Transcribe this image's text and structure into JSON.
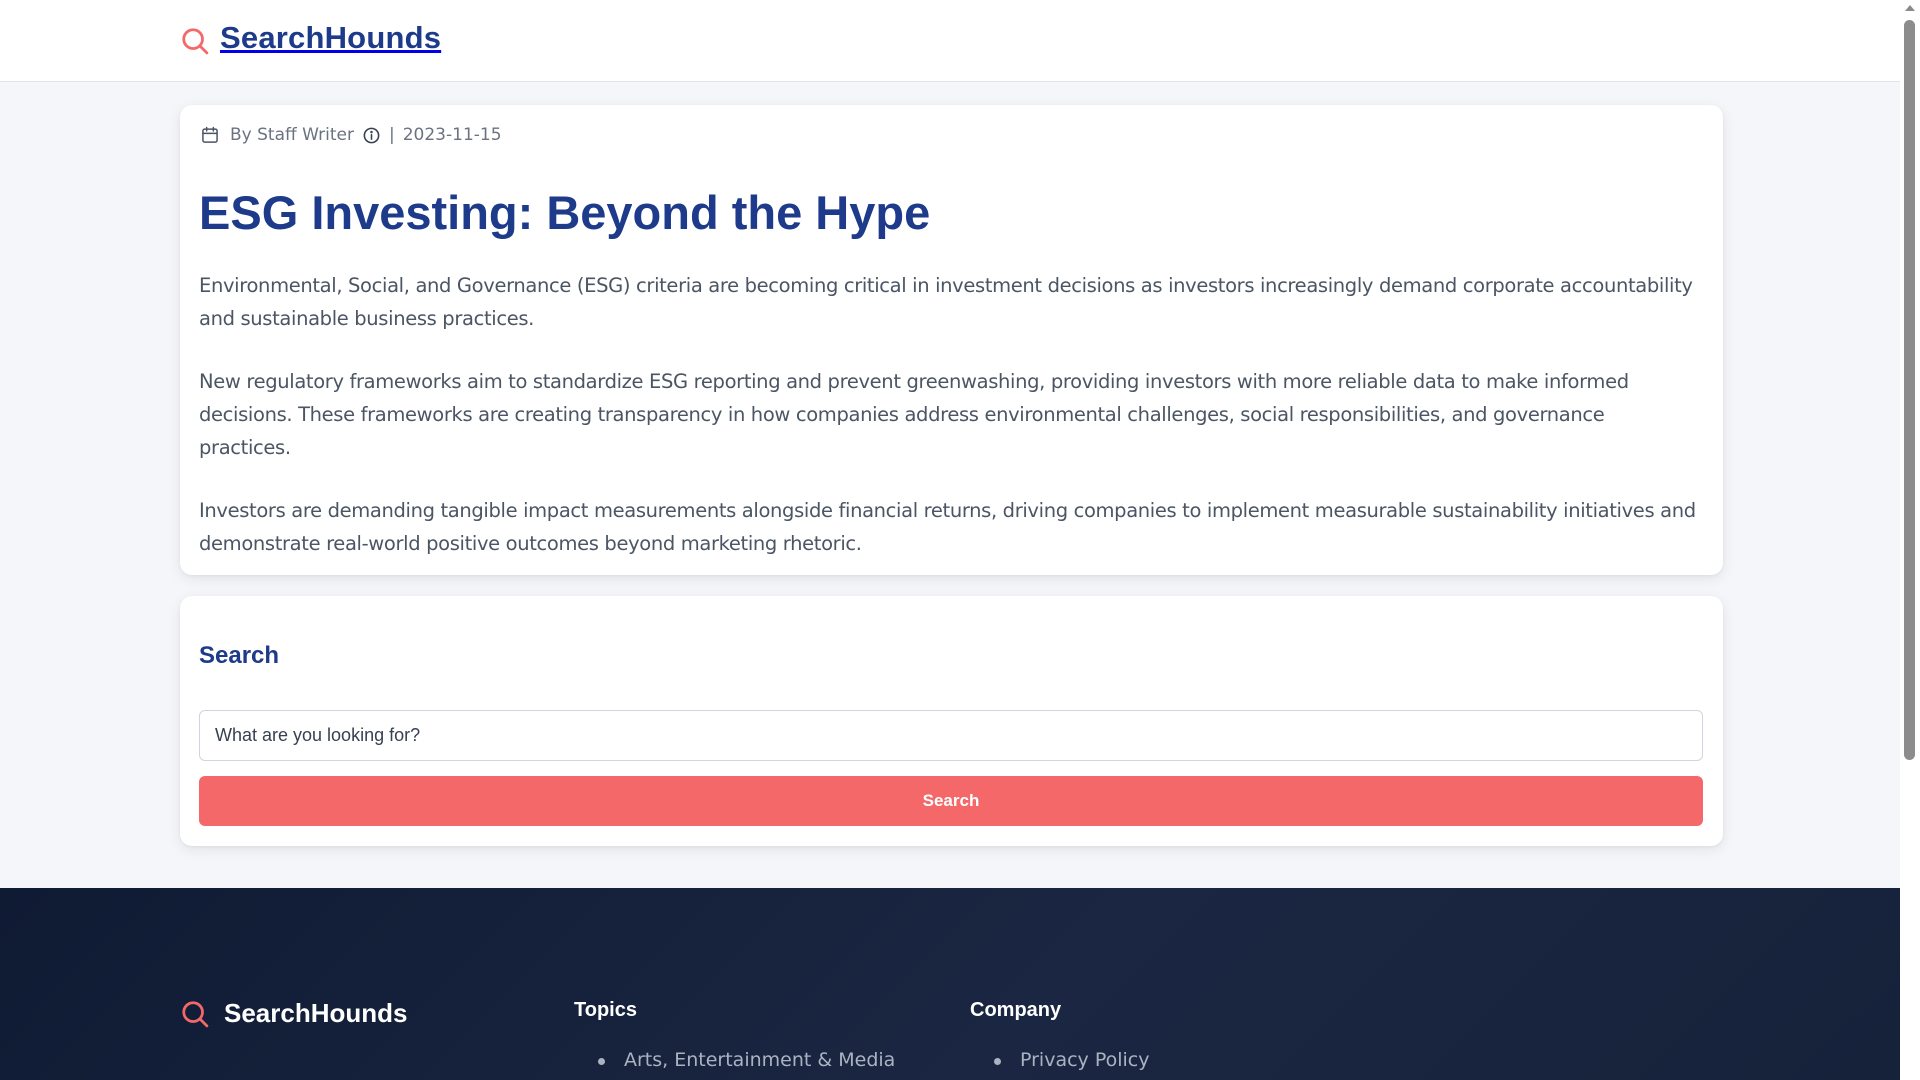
{
  "header": {
    "brand_name": "SearchHounds",
    "logo_icon": "search-icon",
    "accent_color": "#f56869",
    "brand_color": "#1e3a8a"
  },
  "article": {
    "author": "By Staff Writer",
    "separator": "|",
    "date": "2023-11-15",
    "title": "ESG Investing: Beyond the Hype",
    "paragraphs": [
      "Environmental, Social, and Governance (ESG) criteria are becoming critical in investment decisions as investors increasingly demand corporate accountability and sustainable business practices.",
      "New regulatory frameworks aim to standardize ESG reporting and prevent greenwashing, providing investors with more reliable data to make informed decisions. These frameworks are creating transparency in how companies address environmental challenges, social responsibilities, and governance practices.",
      "Investors are demanding tangible impact measurements alongside financial returns, driving companies to implement measurable sustainability initiatives and demonstrate real-world positive outcomes beyond marketing rhetoric."
    ]
  },
  "search": {
    "title": "Search",
    "placeholder": "What are you looking for?",
    "button_label": "Search"
  },
  "footer": {
    "brand_name": "SearchHounds",
    "topics": {
      "heading": "Topics",
      "items": [
        "Arts, Entertainment & Media"
      ]
    },
    "company": {
      "heading": "Company",
      "items": [
        "Privacy Policy"
      ]
    }
  }
}
